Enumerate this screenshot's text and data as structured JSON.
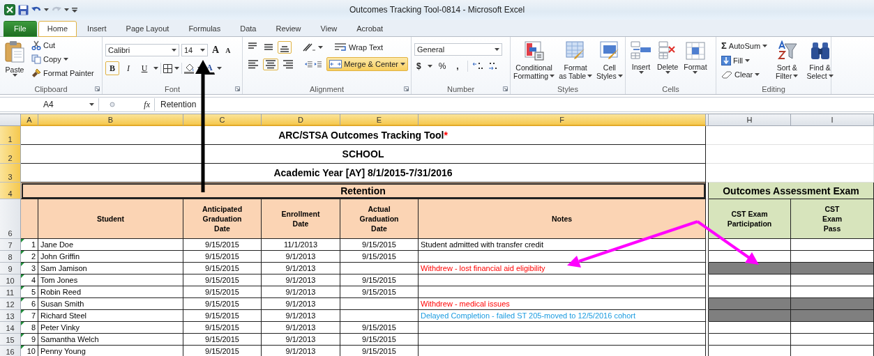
{
  "window": {
    "title": "Outcomes Tracking Tool-0814  -  Microsoft Excel"
  },
  "tabs": [
    {
      "label": "File",
      "kind": "file"
    },
    {
      "label": "Home",
      "kind": "tab",
      "selected": true
    },
    {
      "label": "Insert",
      "kind": "tab",
      "selected": false
    },
    {
      "label": "Page Layout",
      "kind": "tab",
      "selected": false
    },
    {
      "label": "Formulas",
      "kind": "tab",
      "selected": false
    },
    {
      "label": "Data",
      "kind": "tab",
      "selected": false
    },
    {
      "label": "Review",
      "kind": "tab",
      "selected": false
    },
    {
      "label": "View",
      "kind": "tab",
      "selected": false
    },
    {
      "label": "Acrobat",
      "kind": "tab",
      "selected": false
    }
  ],
  "ribbon": {
    "groups": [
      {
        "kind": "clipboard",
        "label": "Clipboard",
        "paste": "Paste",
        "cut": "Cut",
        "copy": "Copy",
        "format_painter": "Format Painter"
      },
      {
        "kind": "font",
        "label": "Font",
        "font_name": "Calibri",
        "font_size": "14",
        "grow": "A",
        "shrink": "A",
        "styles": [
          {
            "label": "B",
            "selected": true
          },
          {
            "label": "I",
            "selected": false
          },
          {
            "label": "U",
            "selected": false
          }
        ],
        "font_color": "A"
      },
      {
        "kind": "alignment",
        "label": "Alignment",
        "vertical": [
          {
            "selected": false
          },
          {
            "selected": false
          },
          {
            "selected": true
          }
        ],
        "horizontal": [
          {
            "selected": false
          },
          {
            "selected": true
          },
          {
            "selected": false
          }
        ],
        "wrap_text": "Wrap Text",
        "merge": {
          "label": "Merge & Center",
          "selected": true
        }
      },
      {
        "kind": "number",
        "label": "Number",
        "format": "General",
        "currency": "$",
        "percent": "%",
        "comma": ","
      },
      {
        "kind": "styles",
        "label": "Styles",
        "buttons": [
          {
            "lines": [
              "Conditional",
              "Formatting"
            ]
          },
          {
            "lines": [
              "Format",
              "as Table"
            ]
          },
          {
            "lines": [
              "Cell",
              "Styles"
            ]
          }
        ]
      },
      {
        "kind": "cells",
        "label": "Cells",
        "buttons": [
          {
            "label": "Insert"
          },
          {
            "label": "Delete"
          },
          {
            "label": "Format"
          }
        ]
      },
      {
        "kind": "editing",
        "label": "Editing",
        "sigma": "Σ",
        "autosum": "AutoSum",
        "fill": "Fill",
        "clear": "Clear",
        "buttons": [
          {
            "lines": [
              "Sort &",
              "Filter"
            ]
          },
          {
            "lines": [
              "Find &",
              "Select"
            ]
          }
        ]
      }
    ]
  },
  "formula_bar": {
    "name_box": "A4",
    "function_label": "fx",
    "formula": "Retention"
  },
  "sheet": {
    "columns": [
      {
        "label": "A",
        "selected": true
      },
      {
        "label": "B",
        "selected": true
      },
      {
        "label": "C",
        "selected": true
      },
      {
        "label": "D",
        "selected": true
      },
      {
        "label": "E",
        "selected": true
      },
      {
        "label": "F",
        "selected": true
      },
      {
        "label": "H",
        "selected": false
      },
      {
        "label": "I",
        "selected": false
      }
    ],
    "row_numbers": [
      {
        "label": "1",
        "selected": true
      },
      {
        "label": "2",
        "selected": true
      },
      {
        "label": "3",
        "selected": true
      },
      {
        "label": "4",
        "selected": true
      },
      {
        "label": "6",
        "selected": false
      }
    ],
    "title": "ARC/STSA Outcomes Tracking Tool",
    "title_mark": "*",
    "school": "SCHOOL",
    "academic_year": "Academic Year [AY] 8/1/2015-7/31/2016",
    "section": "Retention",
    "section_selected": true,
    "exam_section": "Outcomes Assessment Exam",
    "headers": [
      {
        "lines": [
          "Student"
        ]
      },
      {
        "lines": [
          "Anticipated",
          "Graduation",
          "Date"
        ]
      },
      {
        "lines": [
          "Enrollment",
          "Date"
        ]
      },
      {
        "lines": [
          "Actual",
          "Graduation",
          "Date"
        ]
      },
      {
        "lines": [
          "Notes"
        ]
      }
    ],
    "exam_headers": [
      {
        "lines": [
          "CST Exam",
          "Participation"
        ]
      },
      {
        "lines": [
          "CST",
          "Exam",
          "Pass"
        ]
      }
    ],
    "students": [
      {
        "row": "7",
        "number": "1",
        "name": "Jane Doe",
        "anticipated": "9/15/2015",
        "enrollment": "11/1/2013",
        "actual": "9/15/2015",
        "notes": "Student admitted with transfer credit",
        "kind": "plain",
        "flagged": true,
        "exam_shaded": false
      },
      {
        "row": "8",
        "number": "2",
        "name": "John Griffin",
        "anticipated": "9/15/2015",
        "enrollment": "9/1/2013",
        "actual": "9/15/2015",
        "flagged": true,
        "exam_shaded": false
      },
      {
        "row": "9",
        "number": "3",
        "name": "Sam Jamison",
        "anticipated": "9/15/2015",
        "enrollment": "9/1/2013",
        "notes": "Withdrew - lost financial aid eligibility",
        "kind": "withdrawn",
        "flagged": true,
        "exam_shaded": true
      },
      {
        "row": "10",
        "number": "4",
        "name": "Tom Jones",
        "anticipated": "9/15/2015",
        "enrollment": "9/1/2013",
        "actual": "9/15/2015",
        "flagged": true,
        "exam_shaded": false
      },
      {
        "row": "11",
        "number": "5",
        "name": "Robin Reed",
        "anticipated": "9/15/2015",
        "enrollment": "9/1/2013",
        "actual": "9/15/2015",
        "flagged": true,
        "exam_shaded": false
      },
      {
        "row": "12",
        "number": "6",
        "name": "Susan Smith",
        "anticipated": "9/15/2015",
        "enrollment": "9/1/2013",
        "notes": "Withdrew - medical issues",
        "kind": "withdrawn",
        "flagged": true,
        "exam_shaded": true
      },
      {
        "row": "13",
        "number": "7",
        "name": "Richard Steel",
        "anticipated": "9/15/2015",
        "enrollment": "9/1/2013",
        "notes": "Delayed Completion - failed ST 205-moved to 12/5/2016 cohort",
        "kind": "delayed",
        "flagged": true,
        "exam_shaded": true
      },
      {
        "row": "14",
        "number": "8",
        "name": "Peter Vinky",
        "anticipated": "9/15/2015",
        "enrollment": "9/1/2013",
        "actual": "9/15/2015",
        "flagged": true,
        "exam_shaded": false
      },
      {
        "row": "15",
        "number": "9",
        "name": "Samantha Welch",
        "anticipated": "9/15/2015",
        "enrollment": "9/1/2013",
        "actual": "9/15/2015",
        "flagged": true,
        "exam_shaded": false
      },
      {
        "row": "16",
        "number": "10",
        "name": "Penny Young",
        "anticipated": "9/15/2015",
        "enrollment": "9/1/2013",
        "actual": "9/15/2015",
        "flagged": true,
        "exam_shaded": false
      }
    ]
  }
}
